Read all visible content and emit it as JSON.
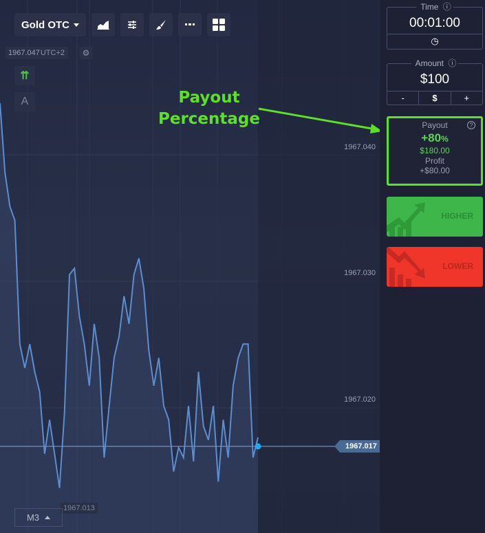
{
  "toolbar": {
    "asset": "Gold OTC",
    "icons": [
      "area-chart-icon",
      "sliders-icon",
      "brush-icon",
      "line-icon",
      "grid-icon"
    ]
  },
  "chart": {
    "timezone": "UTC+2",
    "overlap_price": "1967.047",
    "side_buttons": [
      "⇈",
      "A"
    ],
    "price_ticks": [
      "1967.040",
      "1967.030",
      "1967.020"
    ],
    "current_price": "1967.017",
    "min_price": "1967.013",
    "timeframe": "M3",
    "line_color": "#5b8ed0",
    "series": [
      1967.0435,
      1967.038,
      1967.0353,
      1967.0342,
      1967.0244,
      1967.0225,
      1967.0244,
      1967.0222,
      1967.0206,
      1967.0157,
      1967.0184,
      1967.0157,
      1967.013,
      1967.019,
      1967.0299,
      1967.0304,
      1967.0266,
      1967.0244,
      1967.0211,
      1967.026,
      1967.0233,
      1967.0154,
      1967.0195,
      1967.0233,
      1967.025,
      1967.0282,
      1967.026,
      1967.0299,
      1967.0312,
      1967.0288,
      1967.0239,
      1967.0211,
      1967.0233,
      1967.0195,
      1967.0184,
      1967.0143,
      1967.0162,
      1967.0154,
      1967.0195,
      1967.0151,
      1967.0222,
      1967.0179,
      1967.0168,
      1967.0195,
      1967.0135,
      1967.0184,
      1967.0154,
      1967.0211,
      1967.0233,
      1967.0244,
      1967.0244,
      1967.0154,
      1967.017
    ]
  },
  "annotation": {
    "line1": "Payout",
    "line2": "Percentage",
    "color": "#5ee02a"
  },
  "panel": {
    "time": {
      "label": "Time",
      "value": "00:01:00"
    },
    "amount": {
      "label": "Amount",
      "value": "$100",
      "minus": "-",
      "currency": "$",
      "plus": "+"
    },
    "payout": {
      "label": "Payout",
      "percent": "+80",
      "percent_unit": "%",
      "amount": "$180.00",
      "profit_label": "Profit",
      "profit": "+$80.00"
    },
    "higher": {
      "label": "HIGHER",
      "color": "#3eb649"
    },
    "lower": {
      "label": "LOWER",
      "color": "#f0362b"
    }
  }
}
